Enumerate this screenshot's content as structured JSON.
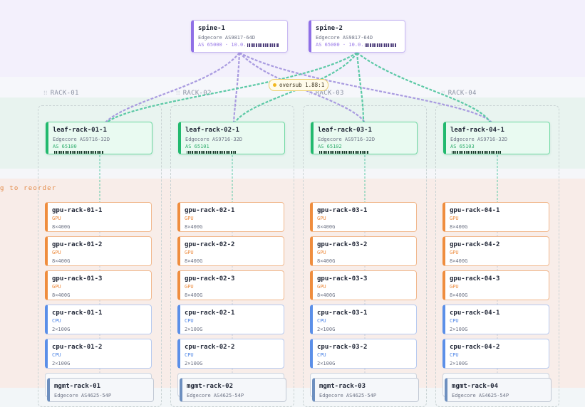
{
  "hint": "g to reorder",
  "oversub": "oversub 1.88:1",
  "spines": [
    {
      "name": "spine-1",
      "model": "Edgecore AS9817-64D",
      "meta": "AS 65000 · 10.0."
    },
    {
      "name": "spine-2",
      "model": "Edgecore AS9817-64D",
      "meta": "AS 65000 · 10.0."
    }
  ],
  "racks": [
    {
      "label": "RACK-01",
      "leaf": {
        "name": "leaf-rack-01-1",
        "model": "Edgecore AS9716-32D",
        "asn": "AS 65100"
      },
      "servers": [
        {
          "name": "gpu-rack-01-1",
          "role": "GPU",
          "ports": "8×400G"
        },
        {
          "name": "gpu-rack-01-2",
          "role": "GPU",
          "ports": "8×400G"
        },
        {
          "name": "gpu-rack-01-3",
          "role": "GPU",
          "ports": "8×400G"
        },
        {
          "name": "cpu-rack-01-1",
          "role": "CPU",
          "ports": "2×100G"
        },
        {
          "name": "cpu-rack-01-2",
          "role": "CPU",
          "ports": "2×100G"
        }
      ],
      "mgmt": {
        "name": "mgmt-rack-01",
        "model": "Edgecore AS4625-54P"
      }
    },
    {
      "label": "RACK-02",
      "leaf": {
        "name": "leaf-rack-02-1",
        "model": "Edgecore AS9716-32D",
        "asn": "AS 65101"
      },
      "servers": [
        {
          "name": "gpu-rack-02-1",
          "role": "GPU",
          "ports": "8×400G"
        },
        {
          "name": "gpu-rack-02-2",
          "role": "GPU",
          "ports": "8×400G"
        },
        {
          "name": "gpu-rack-02-3",
          "role": "GPU",
          "ports": "8×400G"
        },
        {
          "name": "cpu-rack-02-1",
          "role": "CPU",
          "ports": "2×100G"
        },
        {
          "name": "cpu-rack-02-2",
          "role": "CPU",
          "ports": "2×100G"
        }
      ],
      "mgmt": {
        "name": "mgmt-rack-02",
        "model": "Edgecore AS4625-54P"
      }
    },
    {
      "label": "RACK-03",
      "leaf": {
        "name": "leaf-rack-03-1",
        "model": "Edgecore AS9716-32D",
        "asn": "AS 65102"
      },
      "servers": [
        {
          "name": "gpu-rack-03-1",
          "role": "GPU",
          "ports": "8×400G"
        },
        {
          "name": "gpu-rack-03-2",
          "role": "GPU",
          "ports": "8×400G"
        },
        {
          "name": "gpu-rack-03-3",
          "role": "GPU",
          "ports": "8×400G"
        },
        {
          "name": "cpu-rack-03-1",
          "role": "CPU",
          "ports": "2×100G"
        },
        {
          "name": "cpu-rack-03-2",
          "role": "CPU",
          "ports": "2×100G"
        }
      ],
      "mgmt": {
        "name": "mgmt-rack-03",
        "model": "Edgecore AS4625-54P"
      }
    },
    {
      "label": "RACK-04",
      "leaf": {
        "name": "leaf-rack-04-1",
        "model": "Edgecore AS9716-32D",
        "asn": "AS 65103"
      },
      "servers": [
        {
          "name": "gpu-rack-04-1",
          "role": "GPU",
          "ports": "8×400G"
        },
        {
          "name": "gpu-rack-04-2",
          "role": "GPU",
          "ports": "8×400G"
        },
        {
          "name": "gpu-rack-04-3",
          "role": "GPU",
          "ports": "8×400G"
        },
        {
          "name": "cpu-rack-04-1",
          "role": "CPU",
          "ports": "2×100G"
        },
        {
          "name": "cpu-rack-04-2",
          "role": "CPU",
          "ports": "2×100G"
        }
      ],
      "mgmt": {
        "name": "mgmt-rack-04",
        "model": "Edgecore AS4625-54P"
      }
    }
  ],
  "colors": {
    "spine": "#8f6fe6",
    "leaf": "#22b96e",
    "gpu": "#ef8d3e",
    "cpu": "#5b8fe8",
    "mgmt": "#6d8fbf",
    "link_spine": "#a99be0",
    "link_leaf": "#5cc9a6"
  }
}
